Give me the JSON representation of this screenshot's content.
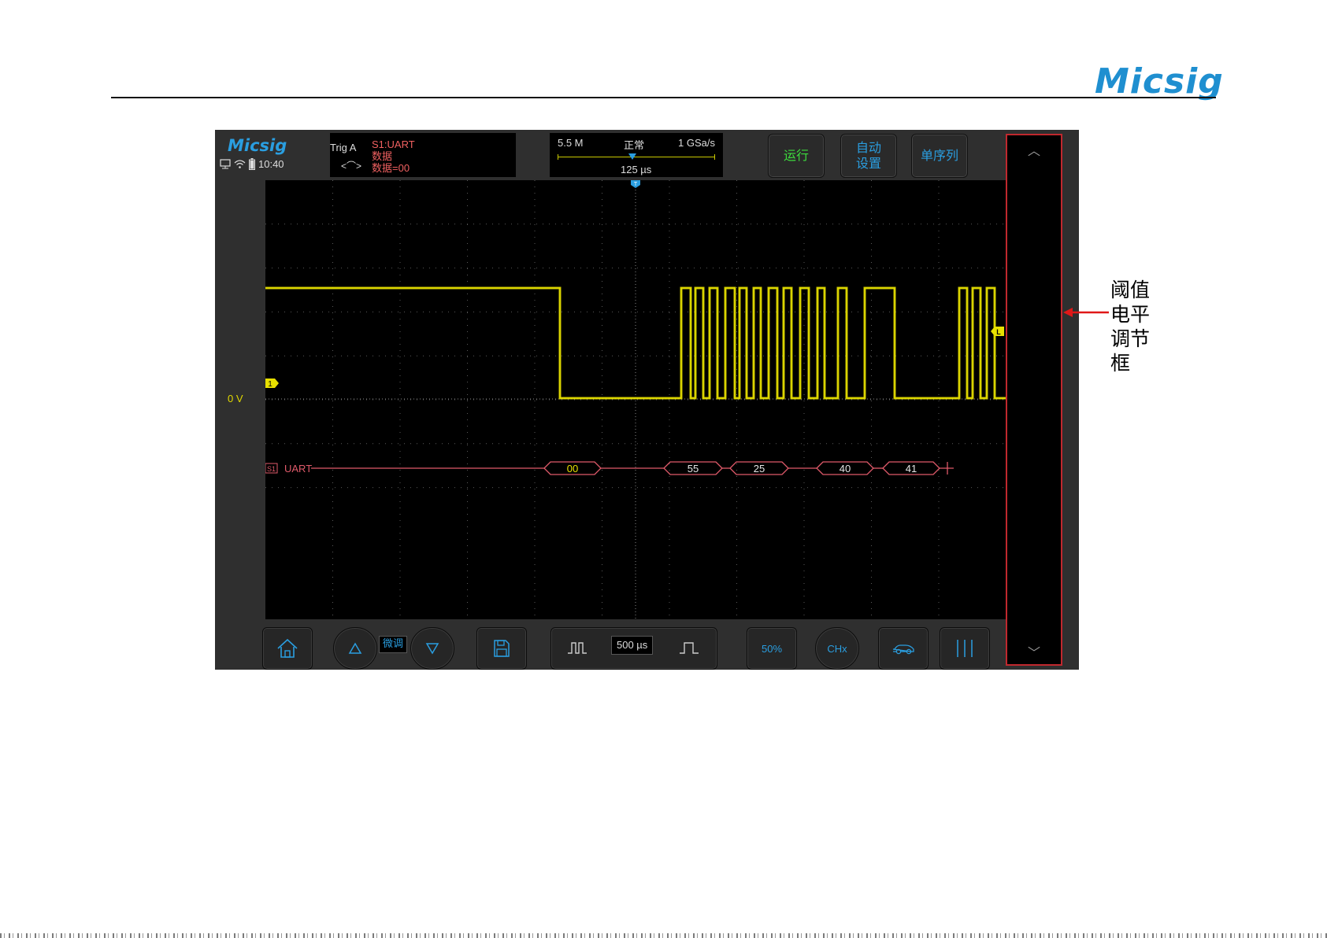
{
  "doc": {
    "brand": "Micsig",
    "annotation": "阈值电平调节框"
  },
  "scope": {
    "brand": "Micsig",
    "time": "10:40",
    "trigger": {
      "label": "Trig A",
      "source": "S1:UART",
      "type": "数据",
      "condition": "数据=00"
    },
    "timebase": {
      "memory_depth": "5.5 M",
      "mode": "正常",
      "sample_rate": "1 GSa/s",
      "offset": "125 µs"
    },
    "buttons": {
      "run": "运行",
      "auto_setup_line1": "自动",
      "auto_setup_line2": "设置",
      "single": "单序列"
    },
    "channel": {
      "zero_label": "0  V",
      "marker": "1",
      "trigger_level_marker": "L"
    },
    "decode": {
      "bus_marker": "S1",
      "bus_label": "UART",
      "packets": [
        "00",
        "55",
        "25",
        "40",
        "41"
      ]
    },
    "bottom": {
      "fine_label": "微调",
      "timebase_scale": "500 µs",
      "fifty_percent": "50%",
      "channel_label": "CHx"
    },
    "colors": {
      "signal": "#e8e000",
      "decode": "#e05a6a",
      "accent": "#2a9ee0",
      "run": "#3ddc3d",
      "annotation_arrow": "#e01818"
    }
  }
}
